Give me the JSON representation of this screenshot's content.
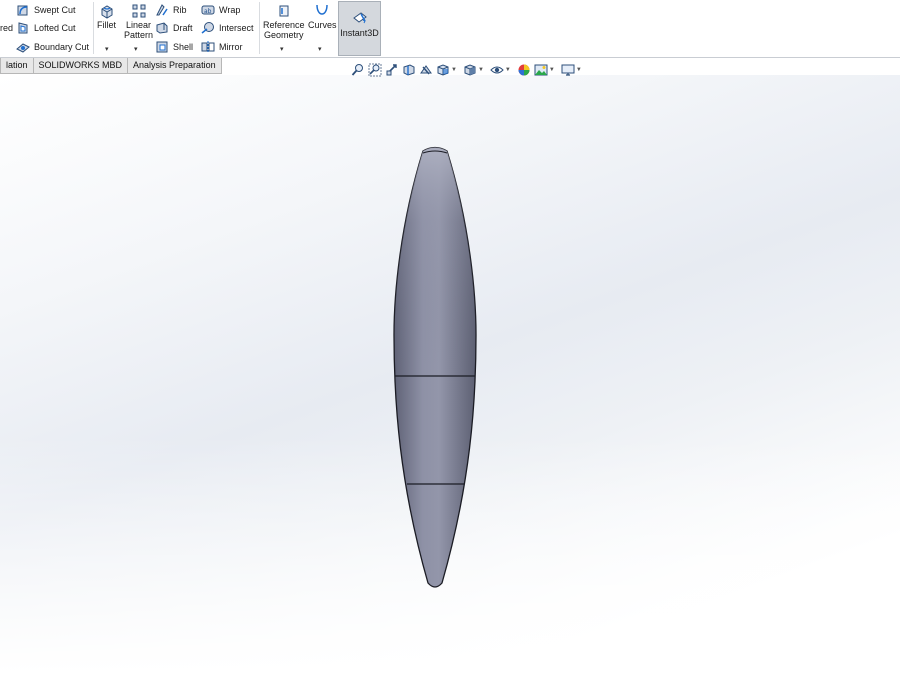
{
  "ribbon": {
    "partial_label": "red",
    "features_left": [
      {
        "label": "Swept Cut",
        "icon": "swept-cut-icon"
      },
      {
        "label": "Lofted Cut",
        "icon": "lofted-cut-icon"
      },
      {
        "label": "Boundary Cut",
        "icon": "boundary-cut-icon"
      }
    ],
    "fillet": {
      "label": "Fillet",
      "icon": "fillet-icon"
    },
    "linear_pattern": {
      "label_line1": "Linear",
      "label_line2": "Pattern",
      "icon": "linear-pattern-icon"
    },
    "features_mid": [
      {
        "label": "Rib",
        "icon": "rib-icon"
      },
      {
        "label": "Draft",
        "icon": "draft-icon"
      },
      {
        "label": "Shell",
        "icon": "shell-icon"
      }
    ],
    "features_right": [
      {
        "label": "Wrap",
        "icon": "wrap-icon"
      },
      {
        "label": "Intersect",
        "icon": "intersect-icon"
      },
      {
        "label": "Mirror",
        "icon": "mirror-icon"
      }
    ],
    "reference_geometry": {
      "label_line1": "Reference",
      "label_line2": "Geometry",
      "icon": "reference-geometry-icon"
    },
    "curves": {
      "label": "Curves",
      "icon": "curves-icon"
    },
    "instant3d": {
      "label": "Instant3D",
      "icon": "instant3d-icon",
      "active": true
    }
  },
  "tabs": [
    {
      "label": "lation"
    },
    {
      "label": "SOLIDWORKS MBD"
    },
    {
      "label": "Analysis Preparation"
    }
  ],
  "heads_up_toolbar": [
    "zoom-to-fit-icon",
    "zoom-to-area-icon",
    "previous-view-icon",
    "section-view-icon",
    "dynamic-annotation-icon",
    "view-orientation-icon",
    "display-style-icon",
    "hide-show-items-icon",
    "edit-appearance-icon",
    "apply-scene-icon",
    "view-settings-icon"
  ],
  "viewport": {
    "part_color": "#7c7f92",
    "background_top": "#e7ebf2",
    "background_bottom": "#ffffff"
  }
}
